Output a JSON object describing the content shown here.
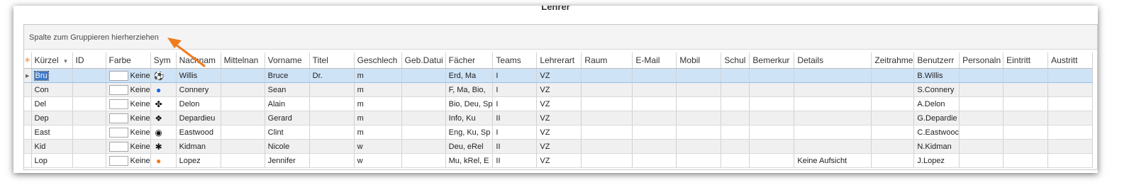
{
  "window_title": "Lehrer",
  "group_hint": "Spalte zum Gruppieren hierherziehen",
  "columns": [
    "Kürzel",
    "ID",
    "Farbe",
    "Sym",
    "Nachnam",
    "Mittelnan",
    "Vorname",
    "Titel",
    "Geschlech",
    "Geb.Datui",
    "Fächer",
    "Teams",
    "Lehrerart",
    "Raum",
    "E-Mail",
    "Mobil",
    "Schul",
    "Bemerkur",
    "Details",
    "Zeitrahmе",
    "Benutzerr",
    "Personaln",
    "Eintritt",
    "Austritt"
  ],
  "rows": [
    {
      "kuerzel": "Bru",
      "farbe": "Keine",
      "sym": "soccer-ball-icon",
      "sym_glyph": "⚽",
      "sym_color": "#111111",
      "nachname": "Willis",
      "vorname": "Bruce",
      "titel": "Dr.",
      "geschlecht": "m",
      "faecher": "Erd, Ma",
      "teams": "I",
      "lehrerart": "VZ",
      "details": "",
      "benutzer": "B.Willis"
    },
    {
      "kuerzel": "Con",
      "farbe": "Keine",
      "sym": "apple-icon",
      "sym_glyph": "●",
      "sym_color": "#1565e0",
      "nachname": "Connery",
      "vorname": "Sean",
      "titel": "",
      "geschlecht": "m",
      "faecher": "F, Ma, Bio,",
      "teams": "I",
      "lehrerart": "VZ",
      "details": "",
      "benutzer": "S.Connery"
    },
    {
      "kuerzel": "Del",
      "farbe": "Keine",
      "sym": "flower-icon",
      "sym_glyph": "✤",
      "sym_color": "#111111",
      "nachname": "Delon",
      "vorname": "Alain",
      "titel": "",
      "geschlecht": "m",
      "faecher": "Bio, Deu, Sp",
      "teams": "I",
      "lehrerart": "VZ",
      "details": "",
      "benutzer": "A.Delon"
    },
    {
      "kuerzel": "Dep",
      "farbe": "Keine",
      "sym": "four-diamonds-icon",
      "sym_glyph": "❖",
      "sym_color": "#111111",
      "nachname": "Depardieu",
      "vorname": "Gerard",
      "titel": "",
      "geschlecht": "m",
      "faecher": "Info, Ku",
      "teams": "II",
      "lehrerart": "VZ",
      "details": "",
      "benutzer": "G.Depardie"
    },
    {
      "kuerzel": "East",
      "farbe": "Keine",
      "sym": "circle-dot-icon",
      "sym_glyph": "◉",
      "sym_color": "#111111",
      "nachname": "Eastwood",
      "vorname": "Clint",
      "titel": "",
      "geschlecht": "m",
      "faecher": "Eng, Ku, Sp",
      "teams": "I",
      "lehrerart": "VZ",
      "details": "",
      "benutzer": "C.Eastwooc"
    },
    {
      "kuerzel": "Kid",
      "farbe": "Keine",
      "sym": "asterisk-icon",
      "sym_glyph": "✱",
      "sym_color": "#111111",
      "nachname": "Kidman",
      "vorname": "Nicole",
      "titel": "",
      "geschlecht": "w",
      "faecher": "Deu, eRel",
      "teams": "II",
      "lehrerart": "VZ",
      "details": "",
      "benutzer": "N.Kidman"
    },
    {
      "kuerzel": "Lop",
      "farbe": "Keine",
      "sym": "orange-apple-icon",
      "sym_glyph": "●",
      "sym_color": "#f07c1c",
      "nachname": "Lopez",
      "vorname": "Jennifer",
      "titel": "",
      "geschlecht": "w",
      "faecher": "Mu, kRel, E",
      "teams": "II",
      "lehrerart": "VZ",
      "details": "Keine Aufsicht",
      "benutzer": "J.Lopez"
    }
  ],
  "colors": {
    "accent_arrow": "#f07c1c",
    "selection": "#cfe3f7",
    "alt_row": "#f0f0f0"
  }
}
